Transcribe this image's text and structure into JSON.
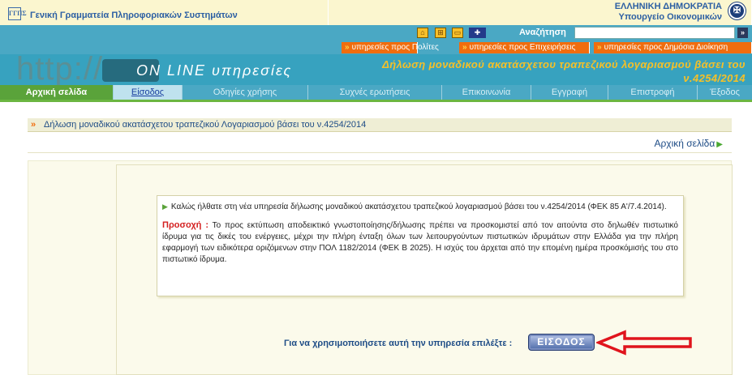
{
  "header": {
    "org_logo_text": "ΓΓΠΣ",
    "org_title": "Γενική Γραμματεία Πληροφοριακών Συστημάτων",
    "gov_line1": "ΕΛΛΗΝΙΚΗ ΔΗΜΟΚΡΑΤΙΑ",
    "gov_line2": "Υπουργείο Οικονομικών"
  },
  "toolbar": {
    "search_label": "Αναζήτηση",
    "search_value": "",
    "search_go": "»"
  },
  "services": [
    "υπηρεσίες προς Πολίτες",
    "υπηρεσίες προς Επιχειρήσεις",
    "υπηρεσίες προς Δημόσια Διοίκηση"
  ],
  "banner": {
    "http_text": "http://",
    "online_text": "ON LINE υπηρεσίες",
    "title_line1": "Δήλωση μοναδικού ακατάσχετου τραπεζικού λογαριασμού βάσει του",
    "title_line2": "ν.4254/2014"
  },
  "nav": [
    {
      "label": "Αρχική σελίδα",
      "state": "active"
    },
    {
      "label": "Είσοδος",
      "state": "link"
    },
    {
      "label": "Οδηγίες χρήσης",
      "state": "normal"
    },
    {
      "label": "Συχνές ερωτήσεις",
      "state": "normal"
    },
    {
      "label": "Επικοινωνία",
      "state": "normal"
    },
    {
      "label": "Εγγραφή",
      "state": "normal"
    },
    {
      "label": "Επιστροφή",
      "state": "normal"
    },
    {
      "label": "Έξοδος",
      "state": "normal"
    }
  ],
  "content": {
    "page_heading": "Δήλωση μοναδικού ακατάσχετου τραπεζικού Λογαριασμού βάσει του ν.4254/2014",
    "home_link": "Αρχική σελίδα",
    "welcome_text": "Καλώς ήλθατε στη νέα υπηρεσία δήλωσης μοναδικού ακατάσχετου τραπεζικού λογαριασμού βάσει του ν.4254/2014 (ΦΕΚ 85 Α'/7.4.2014).",
    "warning_label": "Προσοχή :",
    "warning_text": "Το προς εκτύπωση αποδεικτικό γνωστοποίησης/δήλωσης πρέπει να προσκομιστεί από τον αιτούντα στο δηλωθέν πιστωτικό ίδρυμα για τις δικές του ενέργειες, μέχρι την πλήρη ένταξη όλων των λειτουργούντων πιστωτικών ιδρυμάτων στην Ελλάδα για την πλήρη εφαρμογή των ειδικότερα οριζόμενων στην ΠΟΛ 1182/2014 (ΦΕΚ Β 2025). Η ισχύς του άρχεται από την επομένη ημέρα προσκόμισής του στο πιστωτικό ίδρυμα.",
    "choose_label": "Για να χρησιμοποιήσετε αυτή την υπηρεσία επιλέξτε :",
    "enter_button": "ΕΙΣΟΔΟΣ"
  },
  "icons": [
    "home-icon",
    "sitemap-icon",
    "accessibility-icon",
    "english-flag-icon",
    "greek-emblem-icon"
  ],
  "colors": {
    "nav_active": "#5aa33a",
    "service_orange": "#f06d0e",
    "teal": "#4aa8c4",
    "banner_title": "#f6c028",
    "warning_red": "#d42020"
  }
}
